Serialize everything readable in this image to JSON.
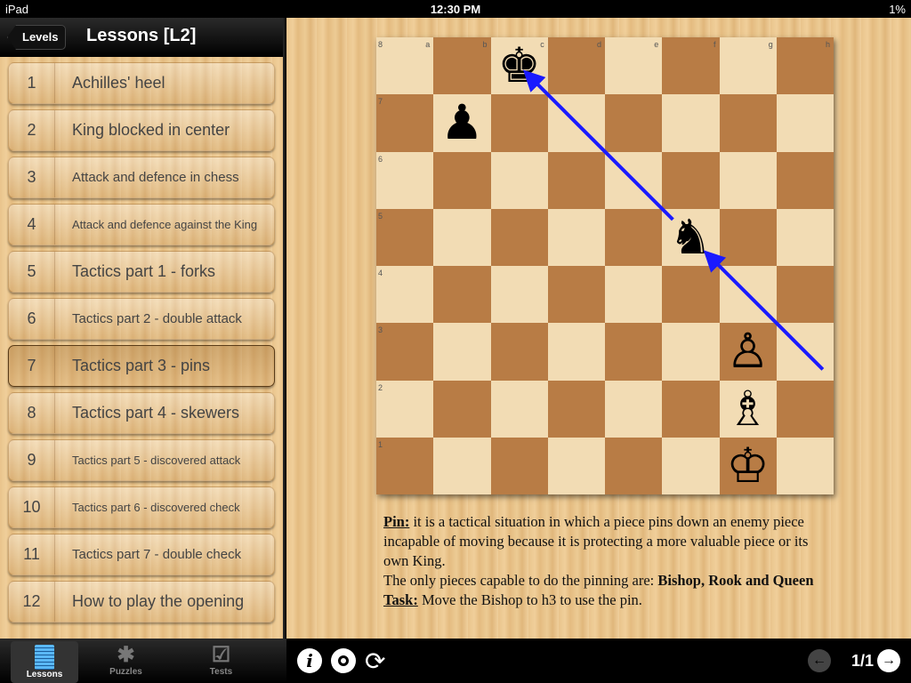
{
  "status": {
    "device": "iPad",
    "time": "12:30 PM",
    "battery": "1%"
  },
  "nav": {
    "back": "Levels",
    "title": "Lessons [L2]"
  },
  "lessons": [
    {
      "n": "1",
      "t": "Achilles' heel"
    },
    {
      "n": "2",
      "t": "King blocked in center"
    },
    {
      "n": "3",
      "t": "Attack and defence in chess"
    },
    {
      "n": "4",
      "t": "Attack and defence against the King"
    },
    {
      "n": "5",
      "t": "Tactics part 1 - forks"
    },
    {
      "n": "6",
      "t": "Tactics part 2 - double attack"
    },
    {
      "n": "7",
      "t": "Tactics part 3 - pins"
    },
    {
      "n": "8",
      "t": "Tactics part 4 - skewers"
    },
    {
      "n": "9",
      "t": "Tactics part 5 - discovered attack"
    },
    {
      "n": "10",
      "t": "Tactics part 6 - discovered check"
    },
    {
      "n": "11",
      "t": "Tactics part 7 - double check"
    },
    {
      "n": "12",
      "t": "How to play the opening"
    }
  ],
  "selected_lesson": "7",
  "tabs": [
    {
      "label": "Lessons",
      "icon": "notepad-icon"
    },
    {
      "label": "Puzzles",
      "icon": "puzzle-icon"
    },
    {
      "label": "Tests",
      "icon": "checkbox-icon"
    }
  ],
  "board": {
    "files": [
      "a",
      "b",
      "c",
      "d",
      "e",
      "f",
      "g",
      "h"
    ],
    "ranks": [
      "8",
      "7",
      "6",
      "5",
      "4",
      "3",
      "2",
      "1"
    ],
    "pieces": [
      {
        "sq": "c8",
        "p": "♚"
      },
      {
        "sq": "b7",
        "p": "♟"
      },
      {
        "sq": "f5",
        "p": "♞"
      },
      {
        "sq": "g3",
        "p": "♙"
      },
      {
        "sq": "g2",
        "p": "♗"
      },
      {
        "sq": "g1",
        "p": "♔"
      }
    ],
    "arrows": [
      [
        "h3",
        "f5"
      ],
      [
        "f5",
        "c8"
      ]
    ],
    "arrow_color": "#1a1aff"
  },
  "text": {
    "pin_label": "Pin:",
    "p1": " it is a tactical situation in which a piece pins down an enemy piece incapable of moving because it is protecting a more valuable piece or its own King.",
    "p2": "The only pieces capable to do the pinning are: ",
    "p2b": "Bishop, Rook and Queen",
    "task_label": "Task:",
    "task": " Move the Bishop to h3 to use the pin."
  },
  "toolbar": {
    "info": "i",
    "page": "1/1",
    "prev": "←",
    "next": "→"
  }
}
